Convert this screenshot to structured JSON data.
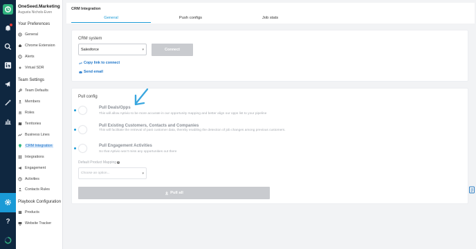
{
  "org": {
    "name": "OneSeed.Marketing",
    "user": "Augusta Nichols-Even"
  },
  "rail": {
    "icons": [
      "logo-icon",
      "bell-icon",
      "search-icon",
      "linkedin-icon",
      "megaphone-icon",
      "wand-icon",
      "chart-icon",
      "gear-icon",
      "help-icon",
      "progress-icon"
    ]
  },
  "sidebar": {
    "preferences_title": "Your Preferences",
    "preferences": [
      {
        "label": "General",
        "icon": "gear-icon"
      },
      {
        "label": "Chrome Extension",
        "icon": "puzzle-icon"
      },
      {
        "label": "Alerts",
        "icon": "alert-icon"
      },
      {
        "label": "Virtual SDR",
        "icon": "sparkle-icon"
      }
    ],
    "team_title": "Team Settings",
    "team": [
      {
        "label": "Team Defaults",
        "icon": "wrench-icon"
      },
      {
        "label": "Members",
        "icon": "person-icon"
      },
      {
        "label": "Roles",
        "icon": "roles-icon"
      },
      {
        "label": "Territories",
        "icon": "map-icon"
      },
      {
        "label": "Business Lines",
        "icon": "trend-icon"
      },
      {
        "label": "CRM Integration",
        "icon": "pin-icon"
      },
      {
        "label": "Integrations",
        "icon": "grid-icon"
      },
      {
        "label": "Engagement",
        "icon": "megaphone-icon"
      },
      {
        "label": "Activities",
        "icon": "clock-icon"
      },
      {
        "label": "Contacts Rules",
        "icon": "contacts-icon"
      }
    ],
    "playbook_title": "Playbook Configuration",
    "playbook": [
      {
        "label": "Products",
        "icon": "box-icon"
      },
      {
        "label": "Website Tracker",
        "icon": "monitor-icon"
      }
    ]
  },
  "header": {
    "title": "CRM Integration",
    "tabs": [
      "General",
      "Push configs",
      "Job stats"
    ],
    "active_tab": "General"
  },
  "crm": {
    "label": "CRM system",
    "value": "Salesforce",
    "connect": "Connect",
    "copy_link": "Copy link to connect",
    "send_email": "Send email"
  },
  "pull": {
    "title": "Pull config",
    "options": [
      {
        "title": "Pull Deals/Opps",
        "desc": "This will allow Aptivio to be more accurate in our opportunity mapping and better align our opps list to your pipeline"
      },
      {
        "title": "Pull Existing Customers, Contacts and Companies",
        "desc": "This will facilitate the retrieval of past customer data, thereby enabling the detection of job changes among previous customers."
      },
      {
        "title": "Pull Engagement Activities",
        "desc": "So that Aptivio won't miss any opportunities out there"
      }
    ],
    "mapping_label": "Default Product Mapping",
    "mapping_placeholder": "Choose an option...",
    "pull_all": "Pull all"
  },
  "colors": {
    "rail": "#0f2740",
    "accent": "#1a9ad6",
    "link": "#1a73c8",
    "brand": "#2fb37f",
    "disabled_button": "#c9cbcf"
  }
}
